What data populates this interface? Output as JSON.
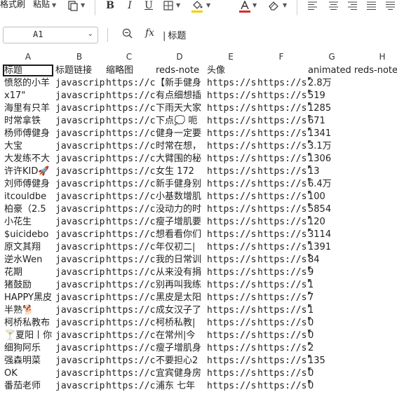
{
  "toolbar": {
    "format_painter": "格式刷",
    "paste": "粘贴",
    "bold": "B",
    "italic": "I",
    "underline": "U"
  },
  "formula_bar": {
    "cell_ref": "A1",
    "content": "标题"
  },
  "colors": {
    "fill": "#f5d000",
    "font": "#d32f2f"
  },
  "columns": [
    "A",
    "B",
    "C",
    "D",
    "E",
    "F",
    "G",
    "H"
  ],
  "rows": [
    {
      "a": "标题",
      "b": "标题链接",
      "c": "缩略图",
      "d": "reds-note",
      "e": "头像",
      "f": "",
      "g": "animated reds-note-like-t",
      "tri": false
    },
    {
      "a": "愤怒的小羊",
      "b": "javascript:",
      "c": "https://c",
      "d": "【新手健身",
      "e": "https://s",
      "f": "https://s",
      "g": "2.8万",
      "tri": true
    },
    {
      "a": "x17\"",
      "b": "javascript:",
      "c": "https://c",
      "d": "有点细想插",
      "e": "https://s",
      "f": "https://s",
      "g": "519",
      "tri": true
    },
    {
      "a": "海里有只羊",
      "b": "javascript:",
      "c": "https://c",
      "d": "下雨天大家",
      "e": "https://s",
      "f": "https://s",
      "g": "1285",
      "tri": true
    },
    {
      "a": "时常拿铁",
      "b": "javascript:",
      "c": "https://c",
      "d": "下点💭 呃",
      "e": "https://s",
      "f": "https://s",
      "g": "671",
      "tri": true
    },
    {
      "a": "杨师傅健身",
      "b": "javascript:",
      "c": "https://c",
      "d": "健身一定要",
      "e": "https://s",
      "f": "https://s",
      "g": "1341",
      "tri": true
    },
    {
      "a": "大宝",
      "b": "javascript:",
      "c": "https://c",
      "d": "时常在想，",
      "e": "https://s",
      "f": "https://s",
      "g": "3.1万",
      "tri": true
    },
    {
      "a": "大发练不大",
      "b": "javascript:",
      "c": "https://c",
      "d": "大臂围的秘",
      "e": "https://s",
      "f": "https://s",
      "g": "1306",
      "tri": true
    },
    {
      "a": "许许KID🚀",
      "b": "javascript:",
      "c": "https://c",
      "d": "女生 172",
      "e": "https://s",
      "f": "https://s",
      "g": "13",
      "tri": true
    },
    {
      "a": "刘师傅健身",
      "b": "javascript:",
      "c": "https://c",
      "d": "新手健身别",
      "e": "https://s",
      "f": "https://s",
      "g": "6.4万",
      "tri": true
    },
    {
      "a": "itcouldbe",
      "b": "javascript:",
      "c": "https://c",
      "d": "小基数增肌",
      "e": "https://s",
      "f": "https://s",
      "g": "100",
      "tri": true
    },
    {
      "a": "柏豪（2.5",
      "b": "javascript:",
      "c": "https://c",
      "d": "没动力的时",
      "e": "https://s",
      "f": "https://s",
      "g": "5854",
      "tri": true
    },
    {
      "a": "小花生",
      "b": "javascript:",
      "c": "https://c",
      "d": "瘦子增肌要",
      "e": "https://s",
      "f": "https://s",
      "g": "120",
      "tri": true
    },
    {
      "a": "$uicidebo",
      "b": "javascript:",
      "c": "https://c",
      "d": "想看看你们",
      "e": "https://s",
      "f": "https://s",
      "g": "3114",
      "tri": true
    },
    {
      "a": "原文其翔",
      "b": "javascript:",
      "c": "https://c",
      "d": "年仅初二|",
      "e": "https://s",
      "f": "https://s",
      "g": "1391",
      "tri": true
    },
    {
      "a": "逆水Wen",
      "b": "javascript:",
      "c": "https://c",
      "d": "我的日常训",
      "e": "https://s",
      "f": "https://s",
      "g": "84",
      "tri": true
    },
    {
      "a": "花期",
      "b": "javascript:",
      "c": "https://c",
      "d": "从来没有捐",
      "e": "https://s",
      "f": "https://s",
      "g": "9",
      "tri": true
    },
    {
      "a": "猪鼓励",
      "b": "javascript:",
      "c": "https://c",
      "d": "别再叫我练",
      "e": "https://s",
      "f": "https://s",
      "g": "1",
      "tri": true
    },
    {
      "a": "HAPPY黑皮",
      "b": "javascript:",
      "c": "https://c",
      "d": "黑皮是太阳",
      "e": "https://s",
      "f": "https://s",
      "g": "7",
      "tri": true
    },
    {
      "a": "半熟🐕",
      "b": "javascript:",
      "c": "https://c",
      "d": "成女汉子了",
      "e": "https://s",
      "f": "https://s",
      "g": "1",
      "tri": true
    },
    {
      "a": "柯桥私教布",
      "b": "javascript:",
      "c": "https://c",
      "d": "柯桥私教|",
      "e": "https://s",
      "f": "https://s",
      "g": "0",
      "tri": true
    },
    {
      "a": "🍸夏阳丨你",
      "b": "javascript:",
      "c": "https://c",
      "d": "在常州|今",
      "e": "https://s",
      "f": "https://s",
      "g": "0",
      "tri": true
    },
    {
      "a": "细狗阿乐",
      "b": "javascript:",
      "c": "https://c",
      "d": "瘦子增肌身",
      "e": "https://s",
      "f": "https://s",
      "g": "2",
      "tri": true
    },
    {
      "a": "强森明菜",
      "b": "javascript:",
      "c": "https://c",
      "d": "不要担心2",
      "e": "https://s",
      "f": "https://s",
      "g": "135",
      "tri": true
    },
    {
      "a": "OK",
      "b": "javascript:",
      "c": "https://c",
      "d": "宜宾健身房",
      "e": "https://s",
      "f": "https://s",
      "g": "0",
      "tri": true
    },
    {
      "a": "番茄老师",
      "b": "javascript:",
      "c": "https://c",
      "d": "浦东 七年",
      "e": "https://s",
      "f": "https://s",
      "g": "0",
      "tri": true
    }
  ]
}
